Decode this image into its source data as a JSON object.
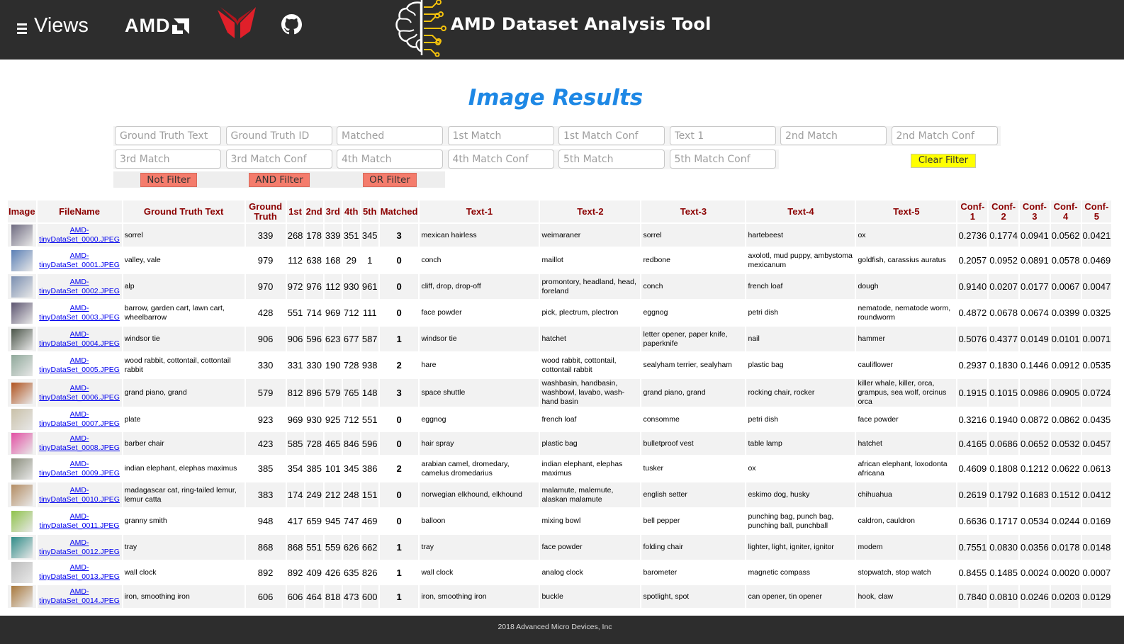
{
  "header": {
    "views_label": "Views",
    "amd_logo_text": "AMD",
    "app_title": "AMD Dataset Analysis Tool",
    "icons": [
      "menu-icon",
      "amd-logo",
      "vega-logo",
      "github-icon",
      "brain-circuit-icon"
    ]
  },
  "page": {
    "title": "Image Results"
  },
  "filters": {
    "row1": [
      "Ground Truth Text",
      "Ground Truth ID",
      "Matched",
      "1st Match",
      "1st Match Conf",
      "Text 1",
      "2nd Match",
      "2nd Match Conf"
    ],
    "row2": [
      "3rd Match",
      "3rd Match Conf",
      "4th Match",
      "4th Match Conf",
      "5th Match",
      "5th Match Conf"
    ],
    "clear_label": "Clear Filter",
    "not_label": "Not Filter",
    "and_label": "AND Filter",
    "or_label": "OR Filter"
  },
  "table": {
    "headers": [
      "Image",
      "FileName",
      "Ground Truth Text",
      "Ground Truth",
      "1st",
      "2nd",
      "3rd",
      "4th",
      "5th",
      "Matched",
      "Text-1",
      "Text-2",
      "Text-3",
      "Text-4",
      "Text-5",
      "Conf-1",
      "Conf-2",
      "Conf-3",
      "Conf-4",
      "Conf-5"
    ],
    "rows": [
      {
        "file": "AMD-tinyDataSet_0000.JPEG",
        "gt_text": "sorrel",
        "gt": "339",
        "m1": "268",
        "m2": "178",
        "m3": "339",
        "m4": "351",
        "m5": "345",
        "matched": "3",
        "t1": "mexican hairless",
        "t2": "weimaraner",
        "t3": "sorrel",
        "t4": "hartebeest",
        "t5": "ox",
        "c1": "0.2736",
        "c2": "0.1774",
        "c3": "0.0941",
        "c4": "0.0562",
        "c5": "0.0421"
      },
      {
        "file": "AMD-tinyDataSet_0001.JPEG",
        "gt_text": "valley, vale",
        "gt": "979",
        "m1": "112",
        "m2": "638",
        "m3": "168",
        "m4": "29",
        "m5": "1",
        "matched": "0",
        "t1": "conch",
        "t2": "maillot",
        "t3": "redbone",
        "t4": "axolotl, mud puppy, ambystoma mexicanum",
        "t5": "goldfish, carassius auratus",
        "c1": "0.2057",
        "c2": "0.0952",
        "c3": "0.0891",
        "c4": "0.0578",
        "c5": "0.0469"
      },
      {
        "file": "AMD-tinyDataSet_0002.JPEG",
        "gt_text": "alp",
        "gt": "970",
        "m1": "972",
        "m2": "976",
        "m3": "112",
        "m4": "930",
        "m5": "961",
        "matched": "0",
        "t1": "cliff, drop, drop-off",
        "t2": "promontory, headland, head, foreland",
        "t3": "conch",
        "t4": "french loaf",
        "t5": "dough",
        "c1": "0.9140",
        "c2": "0.0207",
        "c3": "0.0177",
        "c4": "0.0067",
        "c5": "0.0047"
      },
      {
        "file": "AMD-tinyDataSet_0003.JPEG",
        "gt_text": "barrow, garden cart, lawn cart, wheelbarrow",
        "gt": "428",
        "m1": "551",
        "m2": "714",
        "m3": "969",
        "m4": "712",
        "m5": "111",
        "matched": "0",
        "t1": "face powder",
        "t2": "pick, plectrum, plectron",
        "t3": "eggnog",
        "t4": "petri dish",
        "t5": "nematode, nematode worm, roundworm",
        "c1": "0.4872",
        "c2": "0.0678",
        "c3": "0.0674",
        "c4": "0.0399",
        "c5": "0.0325"
      },
      {
        "file": "AMD-tinyDataSet_0004.JPEG",
        "gt_text": "windsor tie",
        "gt": "906",
        "m1": "906",
        "m2": "596",
        "m3": "623",
        "m4": "677",
        "m5": "587",
        "matched": "1",
        "t1": "windsor tie",
        "t2": "hatchet",
        "t3": "letter opener, paper knife, paperknife",
        "t4": "nail",
        "t5": "hammer",
        "c1": "0.5076",
        "c2": "0.4377",
        "c3": "0.0149",
        "c4": "0.0101",
        "c5": "0.0071"
      },
      {
        "file": "AMD-tinyDataSet_0005.JPEG",
        "gt_text": "wood rabbit, cottontail, cottontail rabbit",
        "gt": "330",
        "m1": "331",
        "m2": "330",
        "m3": "190",
        "m4": "728",
        "m5": "938",
        "matched": "2",
        "t1": "hare",
        "t2": "wood rabbit, cottontail, cottontail rabbit",
        "t3": "sealyham terrier, sealyham",
        "t4": "plastic bag",
        "t5": "cauliflower",
        "c1": "0.2937",
        "c2": "0.1830",
        "c3": "0.1446",
        "c4": "0.0912",
        "c5": "0.0535"
      },
      {
        "file": "AMD-tinyDataSet_0006.JPEG",
        "gt_text": "grand piano, grand",
        "gt": "579",
        "m1": "812",
        "m2": "896",
        "m3": "579",
        "m4": "765",
        "m5": "148",
        "matched": "3",
        "t1": "space shuttle",
        "t2": "washbasin, handbasin, washbowl, lavabo, wash-hand basin",
        "t3": "grand piano, grand",
        "t4": "rocking chair, rocker",
        "t5": "killer whale, killer, orca, grampus, sea wolf, orcinus orca",
        "c1": "0.1915",
        "c2": "0.1015",
        "c3": "0.0986",
        "c4": "0.0905",
        "c5": "0.0724"
      },
      {
        "file": "AMD-tinyDataSet_0007.JPEG",
        "gt_text": "plate",
        "gt": "923",
        "m1": "969",
        "m2": "930",
        "m3": "925",
        "m4": "712",
        "m5": "551",
        "matched": "0",
        "t1": "eggnog",
        "t2": "french loaf",
        "t3": "consomme",
        "t4": "petri dish",
        "t5": "face powder",
        "c1": "0.3216",
        "c2": "0.1940",
        "c3": "0.0872",
        "c4": "0.0862",
        "c5": "0.0435"
      },
      {
        "file": "AMD-tinyDataSet_0008.JPEG",
        "gt_text": "barber chair",
        "gt": "423",
        "m1": "585",
        "m2": "728",
        "m3": "465",
        "m4": "846",
        "m5": "596",
        "matched": "0",
        "t1": "hair spray",
        "t2": "plastic bag",
        "t3": "bulletproof vest",
        "t4": "table lamp",
        "t5": "hatchet",
        "c1": "0.4165",
        "c2": "0.0686",
        "c3": "0.0652",
        "c4": "0.0532",
        "c5": "0.0457"
      },
      {
        "file": "AMD-tinyDataSet_0009.JPEG",
        "gt_text": "indian elephant, elephas maximus",
        "gt": "385",
        "m1": "354",
        "m2": "385",
        "m3": "101",
        "m4": "345",
        "m5": "386",
        "matched": "2",
        "t1": "arabian camel, dromedary, camelus dromedarius",
        "t2": "indian elephant, elephas maximus",
        "t3": "tusker",
        "t4": "ox",
        "t5": "african elephant, loxodonta africana",
        "c1": "0.4609",
        "c2": "0.1808",
        "c3": "0.1212",
        "c4": "0.0622",
        "c5": "0.0613"
      },
      {
        "file": "AMD-tinyDataSet_0010.JPEG",
        "gt_text": "madagascar cat, ring-tailed lemur, lemur catta",
        "gt": "383",
        "m1": "174",
        "m2": "249",
        "m3": "212",
        "m4": "248",
        "m5": "151",
        "matched": "0",
        "t1": "norwegian elkhound, elkhound",
        "t2": "malamute, malemute, alaskan malamute",
        "t3": "english setter",
        "t4": "eskimo dog, husky",
        "t5": "chihuahua",
        "c1": "0.2619",
        "c2": "0.1792",
        "c3": "0.1683",
        "c4": "0.1512",
        "c5": "0.0412"
      },
      {
        "file": "AMD-tinyDataSet_0011.JPEG",
        "gt_text": "granny smith",
        "gt": "948",
        "m1": "417",
        "m2": "659",
        "m3": "945",
        "m4": "747",
        "m5": "469",
        "matched": "0",
        "t1": "balloon",
        "t2": "mixing bowl",
        "t3": "bell pepper",
        "t4": "punching bag, punch bag, punching ball, punchball",
        "t5": "caldron, cauldron",
        "c1": "0.6636",
        "c2": "0.1717",
        "c3": "0.0534",
        "c4": "0.0244",
        "c5": "0.0169"
      },
      {
        "file": "AMD-tinyDataSet_0012.JPEG",
        "gt_text": "tray",
        "gt": "868",
        "m1": "868",
        "m2": "551",
        "m3": "559",
        "m4": "626",
        "m5": "662",
        "matched": "1",
        "t1": "tray",
        "t2": "face powder",
        "t3": "folding chair",
        "t4": "lighter, light, igniter, ignitor",
        "t5": "modem",
        "c1": "0.7551",
        "c2": "0.0830",
        "c3": "0.0356",
        "c4": "0.0178",
        "c5": "0.0148"
      },
      {
        "file": "AMD-tinyDataSet_0013.JPEG",
        "gt_text": "wall clock",
        "gt": "892",
        "m1": "892",
        "m2": "409",
        "m3": "426",
        "m4": "635",
        "m5": "826",
        "matched": "1",
        "t1": "wall clock",
        "t2": "analog clock",
        "t3": "barometer",
        "t4": "magnetic compass",
        "t5": "stopwatch, stop watch",
        "c1": "0.8455",
        "c2": "0.1485",
        "c3": "0.0024",
        "c4": "0.0020",
        "c5": "0.0007"
      },
      {
        "file": "AMD-tinyDataSet_0014.JPEG",
        "gt_text": "iron, smoothing iron",
        "gt": "606",
        "m1": "606",
        "m2": "464",
        "m3": "818",
        "m4": "473",
        "m5": "600",
        "matched": "1",
        "t1": "iron, smoothing iron",
        "t2": "buckle",
        "t3": "spotlight, spot",
        "t4": "can opener, tin opener",
        "t5": "hook, claw",
        "c1": "0.7840",
        "c2": "0.0810",
        "c3": "0.0246",
        "c4": "0.0203",
        "c5": "0.0129"
      }
    ],
    "thumb_colors": [
      "#6e6a80",
      "#5a7fb5",
      "#7a8eb0",
      "#5c5470",
      "#4a5448",
      "#8fa89a",
      "#b0521e",
      "#c9c0a8",
      "#e24fa3",
      "#8a8d7c",
      "#b38c62",
      "#8fc24a",
      "#2f8c88",
      "#bdbdbd",
      "#a8783c"
    ]
  },
  "footer": {
    "text": "2018 Advanced Micro Devices, Inc"
  },
  "colors": {
    "header_bg": "#2d2d2d",
    "title_blue": "#1e88e5",
    "th_text": "#8b0000",
    "match_green": "#1aa61a",
    "match_red": "#ff0000",
    "clear_yellow": "#ffff00",
    "logic_red": "#f47c6c"
  }
}
